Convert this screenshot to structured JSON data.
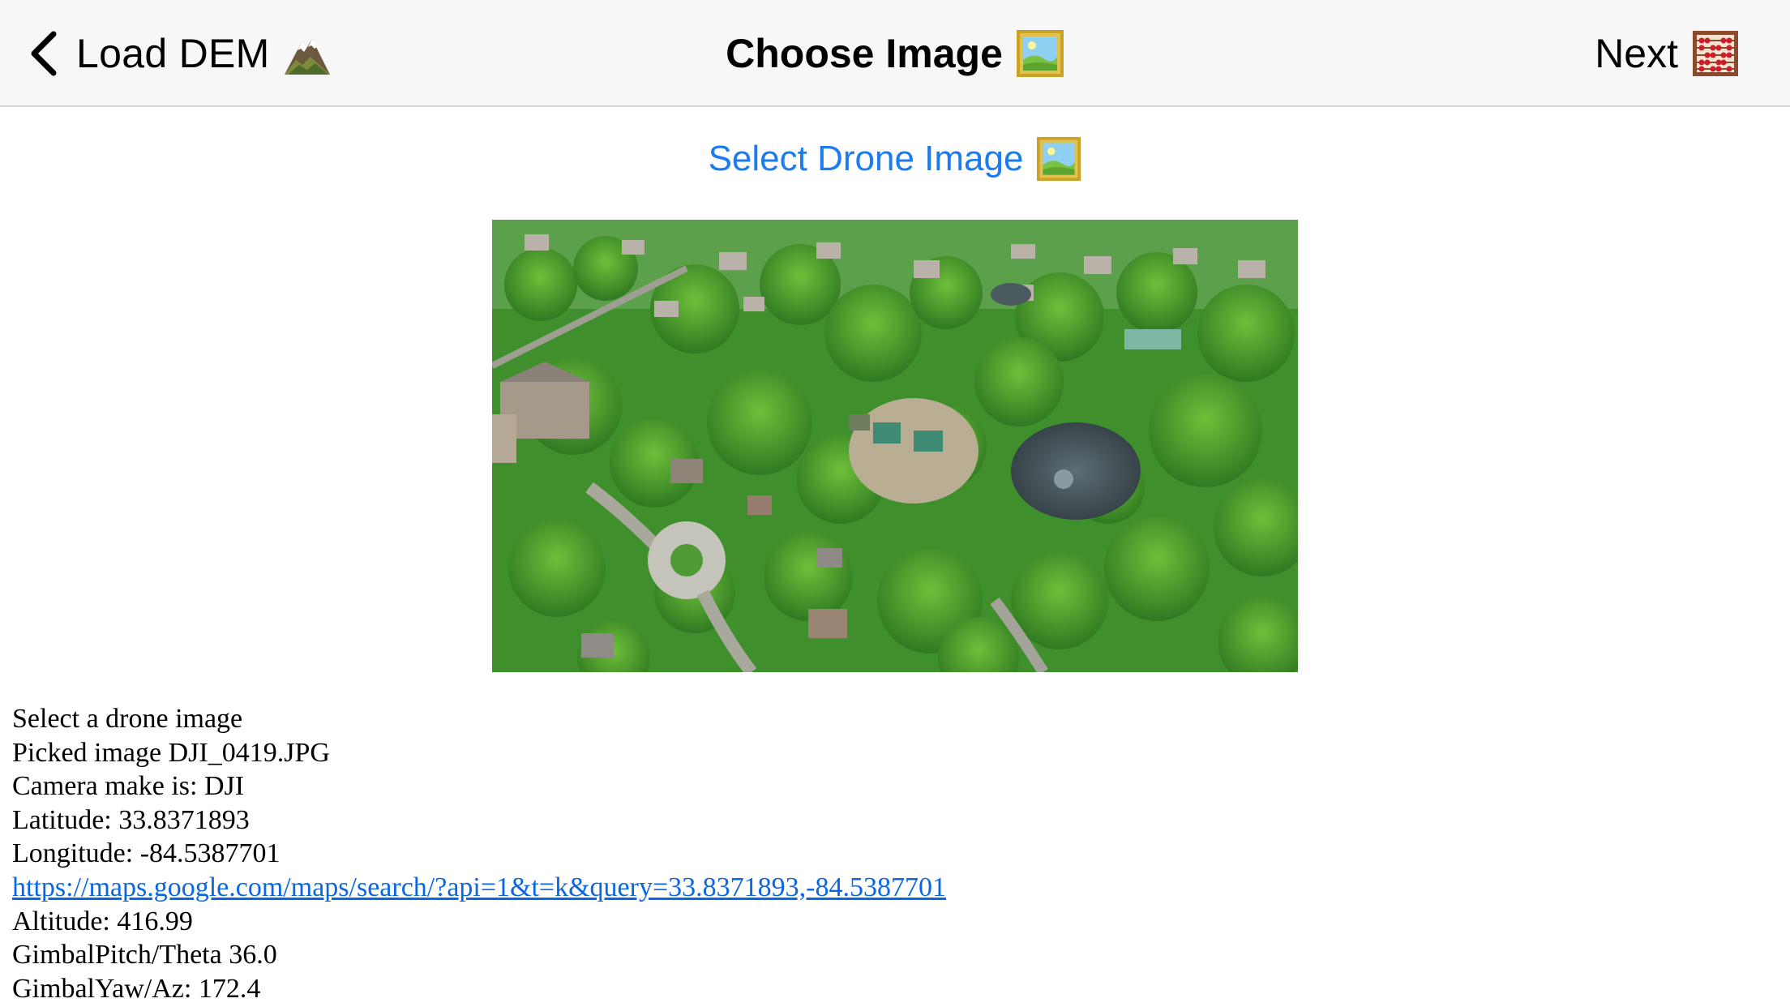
{
  "navbar": {
    "back_label": "Load DEM",
    "back_icon": "mountain-icon",
    "title": "Choose Image",
    "title_icon": "framed-picture-icon",
    "next_label": "Next",
    "next_icon": "abacus-icon"
  },
  "select_button": {
    "label": "Select Drone Image",
    "icon": "framed-picture-icon"
  },
  "image": {
    "description_icon": "aerial-drone-photo"
  },
  "info": {
    "line1": "Select a drone image",
    "line2": "Picked image DJI_0419.JPG",
    "line3": "Camera make is: DJI",
    "line4": "Latitude: 33.8371893",
    "line5": "Longitude: -84.5387701",
    "link": "https://maps.google.com/maps/search/?api=1&t=k&query=33.8371893,-84.5387701",
    "line6": "Altitude: 416.99",
    "line7": "GimbalPitch/Theta 36.0",
    "line8": "GimbalYaw/Az: 172.4"
  },
  "colors": {
    "accent": "#1a7cf0",
    "link": "#0b66e4",
    "navbar_bg": "#f7f7f7"
  }
}
